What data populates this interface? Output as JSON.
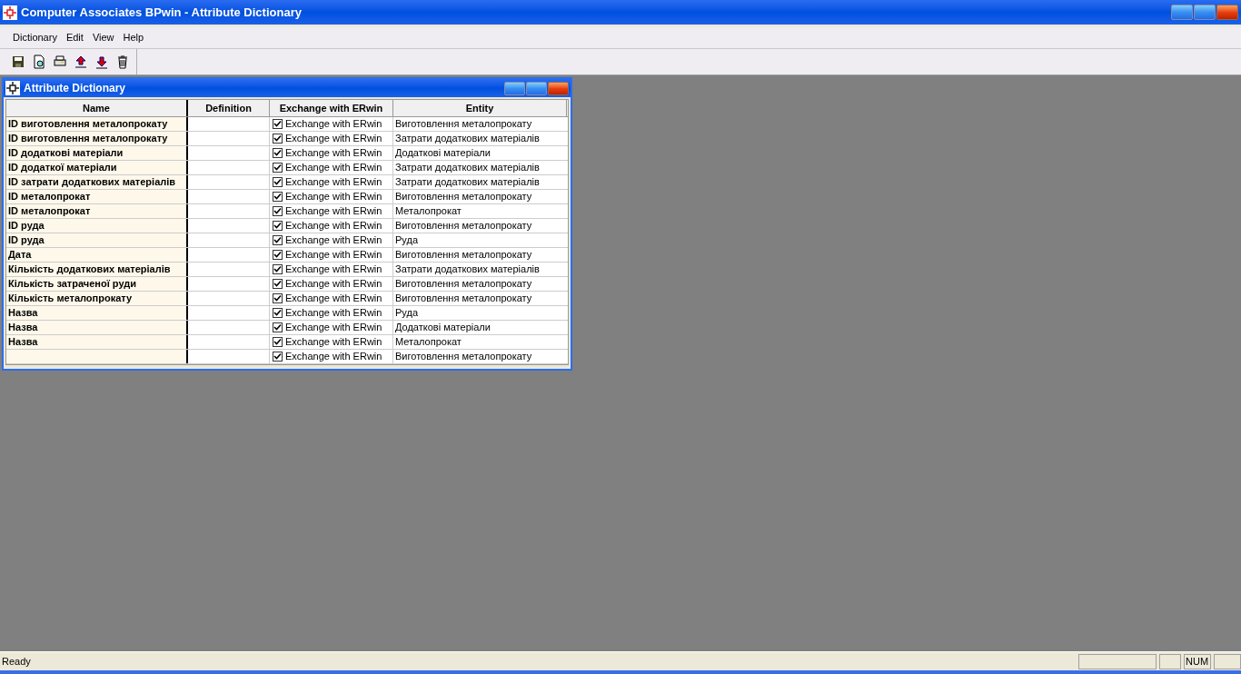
{
  "window": {
    "title": "Computer Associates BPwin - Attribute Dictionary"
  },
  "menu": [
    "Dictionary",
    "Edit",
    "View",
    "Help"
  ],
  "child_window": {
    "title": "Attribute Dictionary"
  },
  "table": {
    "columns": [
      "Name",
      "Definition",
      "Exchange with ERwin",
      "Entity"
    ],
    "rows": [
      {
        "name": "ID виготовлення металопрокату",
        "exchange": {
          "label": "Exchange with ERwin",
          "checked": true
        },
        "entity": "Виготовлення металопрокату"
      },
      {
        "name": "ID виготовлення металопрокату",
        "exchange": {
          "label": "Exchange with ERwin",
          "checked": true
        },
        "entity": "Затрати додаткових матеріалів"
      },
      {
        "name": "ID додаткові матеріали",
        "exchange": {
          "label": "Exchange with ERwin",
          "checked": true
        },
        "entity": "Додаткові матеріали"
      },
      {
        "name": "ID додаткої матеріали",
        "exchange": {
          "label": "Exchange with ERwin",
          "checked": true
        },
        "entity": "Затрати додаткових матеріалів"
      },
      {
        "name": "ID затрати додаткових матеріалів",
        "exchange": {
          "label": "Exchange with ERwin",
          "checked": true
        },
        "entity": "Затрати додаткових матеріалів"
      },
      {
        "name": "ID металопрокат",
        "exchange": {
          "label": "Exchange with ERwin",
          "checked": true
        },
        "entity": "Виготовлення металопрокату"
      },
      {
        "name": "ID металопрокат",
        "exchange": {
          "label": "Exchange with ERwin",
          "checked": true
        },
        "entity": "Металопрокат"
      },
      {
        "name": "ID руда",
        "exchange": {
          "label": "Exchange with ERwin",
          "checked": true
        },
        "entity": "Виготовлення металопрокату"
      },
      {
        "name": "ID руда",
        "exchange": {
          "label": "Exchange with ERwin",
          "checked": true
        },
        "entity": "Руда"
      },
      {
        "name": "Дата",
        "exchange": {
          "label": "Exchange with ERwin",
          "checked": true
        },
        "entity": "Виготовлення металопрокату"
      },
      {
        "name": "Кількість додаткових матеріалів",
        "exchange": {
          "label": "Exchange with ERwin",
          "checked": true
        },
        "entity": "Затрати додаткових матеріалів"
      },
      {
        "name": "Кількість затраченої руди",
        "exchange": {
          "label": "Exchange with ERwin",
          "checked": true
        },
        "entity": "Виготовлення металопрокату"
      },
      {
        "name": "Кількість металопрокату",
        "exchange": {
          "label": "Exchange with ERwin",
          "checked": true
        },
        "entity": "Виготовлення металопрокату"
      },
      {
        "name": "Назва",
        "exchange": {
          "label": "Exchange with ERwin",
          "checked": true
        },
        "entity": "Руда"
      },
      {
        "name": "Назва",
        "exchange": {
          "label": "Exchange with ERwin",
          "checked": true
        },
        "entity": "Додаткові матеріали"
      },
      {
        "name": "Назва",
        "exchange": {
          "label": "Exchange with ERwin",
          "checked": true
        },
        "entity": "Металопрокат"
      },
      {
        "exchange": {
          "label": "Exchange with ERwin",
          "checked": true
        },
        "entity": "Виготовлення металопрокату"
      }
    ]
  },
  "status_bar": {
    "message": "Ready",
    "indicators": [
      "NUM"
    ]
  }
}
